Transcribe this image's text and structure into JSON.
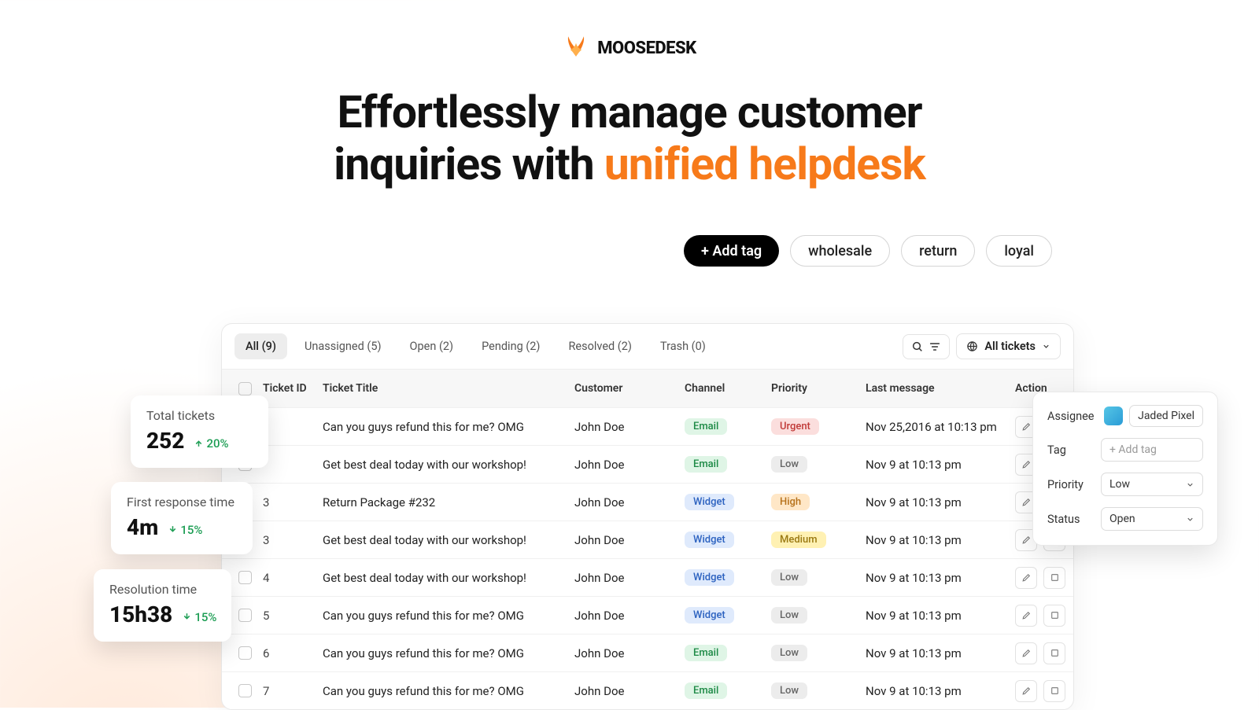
{
  "brand": {
    "name": "MOOSEDESK"
  },
  "hero": {
    "line1": "Effortlessly manage customer",
    "line2_a": "inquiries with ",
    "line2_b": "unified helpdesk"
  },
  "tag_row": {
    "add_tag": "+ Add tag",
    "tags": [
      "wholesale",
      "return",
      "loyal"
    ]
  },
  "tabs": [
    {
      "label": "All (9)",
      "active": true
    },
    {
      "label": "Unassigned (5)",
      "active": false
    },
    {
      "label": "Open (2)",
      "active": false
    },
    {
      "label": "Pending (2)",
      "active": false
    },
    {
      "label": "Resolved (2)",
      "active": false
    },
    {
      "label": "Trash (0)",
      "active": false
    }
  ],
  "all_tickets_label": "All tickets",
  "columns": {
    "id": "Ticket ID",
    "title": "Ticket Title",
    "customer": "Customer",
    "channel": "Channel",
    "priority": "Priority",
    "last": "Last message",
    "action": "Action"
  },
  "rows": [
    {
      "id": "",
      "title": "Can you guys refund this for me? OMG",
      "customer": "John Doe",
      "channel": "Email",
      "priority": "Urgent",
      "last": "Nov 25,2016 at 10:13 pm"
    },
    {
      "id": "",
      "title": "Get best deal today with our workshop!",
      "customer": "John Doe",
      "channel": "Email",
      "priority": "Low",
      "last": "Nov 9 at 10:13 pm"
    },
    {
      "id": "3",
      "title": "Return Package #232",
      "customer": "John Doe",
      "channel": "Widget",
      "priority": "High",
      "last": "Nov 9 at 10:13 pm"
    },
    {
      "id": "3",
      "title": "Get best deal today with our workshop!",
      "customer": "John Doe",
      "channel": "Widget",
      "priority": "Medium",
      "last": "Nov 9 at 10:13 pm"
    },
    {
      "id": "4",
      "title": "Get best deal today with our workshop!",
      "customer": "John Doe",
      "channel": "Widget",
      "priority": "Low",
      "last": "Nov 9 at 10:13 pm"
    },
    {
      "id": "5",
      "title": "Can you guys refund this for me? OMG",
      "customer": "John Doe",
      "channel": "Widget",
      "priority": "Low",
      "last": "Nov 9 at 10:13 pm"
    },
    {
      "id": "6",
      "title": "Can you guys refund this for me? OMG",
      "customer": "John Doe",
      "channel": "Email",
      "priority": "Low",
      "last": "Nov 9 at 10:13 pm"
    },
    {
      "id": "7",
      "title": "Can you guys refund this for me? OMG",
      "customer": "John Doe",
      "channel": "Email",
      "priority": "Low",
      "last": "Nov 9 at 10:13 pm"
    }
  ],
  "panel": {
    "assignee_label": "Assignee",
    "assignee_value": "Jaded Pixel",
    "tag_label": "Tag",
    "tag_placeholder": "+ Add tag",
    "priority_label": "Priority",
    "priority_value": "Low",
    "status_label": "Status",
    "status_value": "Open"
  },
  "stats": {
    "total": {
      "label": "Total tickets",
      "value": "252",
      "delta": "20%",
      "dir": "up"
    },
    "first": {
      "label": "First response time",
      "value": "4m",
      "delta": "15%",
      "dir": "down"
    },
    "res": {
      "label": "Resolution time",
      "value": "15h38",
      "delta": "15%",
      "dir": "down"
    }
  }
}
